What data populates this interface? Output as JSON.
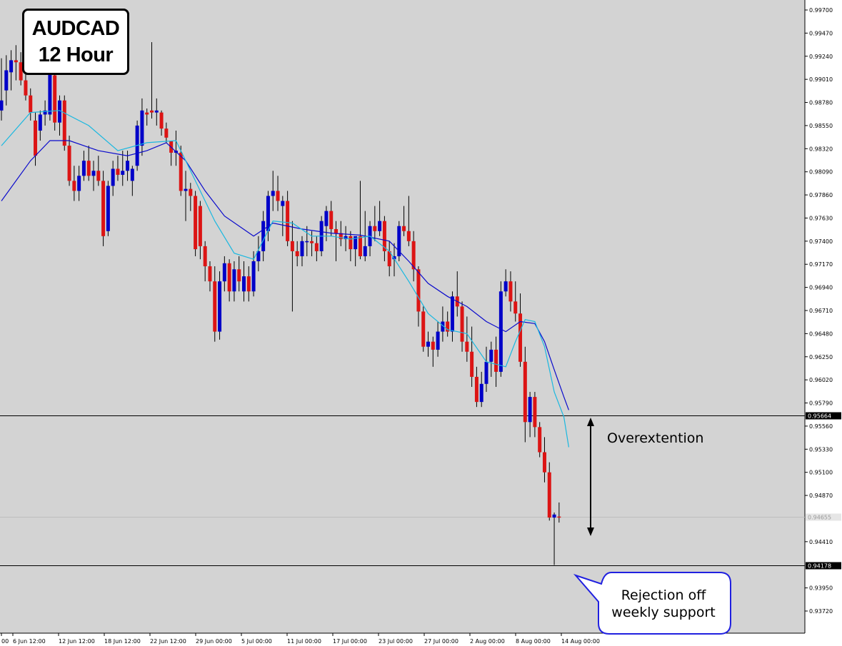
{
  "title": {
    "line1": "AUDCAD",
    "line2": "12 Hour"
  },
  "annotations": {
    "overextension": "Overextention",
    "rejection_line1": "Rejection off",
    "rejection_line2": "weekly support"
  },
  "colors": {
    "background": "#d3d3d3",
    "bull_candle": "#0000c8",
    "bear_candle": "#dc1414",
    "wick": "#000000",
    "ema_fast": "#1ab8e0",
    "ema_slow": "#0a0acc",
    "level_line": "#000000",
    "callout_border": "#2020e0"
  },
  "chart_data": {
    "type": "candlestick",
    "symbol": "AUDCAD",
    "timeframe": "12 Hour",
    "y_ticks": [
      "0.99700",
      "0.99470",
      "0.99240",
      "0.99010",
      "0.98780",
      "0.98550",
      "0.98320",
      "0.98090",
      "0.97860",
      "0.97630",
      "0.97400",
      "0.97170",
      "0.96940",
      "0.96710",
      "0.96480",
      "0.96250",
      "0.96020",
      "0.95790",
      "0.95560",
      "0.95330",
      "0.95100",
      "0.94870",
      "0.94410",
      "0.93950",
      "0.93720"
    ],
    "x_ticks": [
      "00",
      "6 Jun 12:00",
      "12 Jun 12:00",
      "18 Jun 12:00",
      "22 Jun 12:00",
      "29 Jun 00:00",
      "5 Jul 00:00",
      "11 Jul 00:00",
      "17 Jul 00:00",
      "23 Jul 00:00",
      "27 Jul 00:00",
      "2 Aug 00:00",
      "8 Aug 00:00",
      "14 Aug 00:00"
    ],
    "ylim": [
      0.936,
      0.998
    ],
    "levels": [
      {
        "value": 0.95664,
        "label": "0.95664"
      },
      {
        "value": 0.94178,
        "label": "0.94178"
      }
    ],
    "current_price": {
      "value": 0.94655,
      "label": "0.94655"
    },
    "candles": [
      [
        0.987,
        0.9922,
        0.986,
        0.988
      ],
      [
        0.989,
        0.9925,
        0.9875,
        0.991
      ],
      [
        0.9908,
        0.993,
        0.989,
        0.992
      ],
      [
        0.992,
        0.9935,
        0.99,
        0.9918
      ],
      [
        0.9918,
        0.9928,
        0.9895,
        0.99
      ],
      [
        0.99,
        0.991,
        0.988,
        0.9885
      ],
      [
        0.9885,
        0.9892,
        0.986,
        0.9868
      ],
      [
        0.986,
        0.9868,
        0.9815,
        0.9825
      ],
      [
        0.985,
        0.987,
        0.984,
        0.9866
      ],
      [
        0.9866,
        0.988,
        0.9855,
        0.987
      ],
      [
        0.9866,
        0.992,
        0.986,
        0.991
      ],
      [
        0.9905,
        0.9915,
        0.985,
        0.9858
      ],
      [
        0.9858,
        0.9885,
        0.9845,
        0.988
      ],
      [
        0.988,
        0.9885,
        0.983,
        0.9835
      ],
      [
        0.9835,
        0.9845,
        0.9795,
        0.98
      ],
      [
        0.98,
        0.9815,
        0.978,
        0.979
      ],
      [
        0.979,
        0.9815,
        0.978,
        0.9805
      ],
      [
        0.9805,
        0.983,
        0.98,
        0.982
      ],
      [
        0.982,
        0.9835,
        0.98,
        0.9805
      ],
      [
        0.9805,
        0.982,
        0.979,
        0.981
      ],
      [
        0.981,
        0.9825,
        0.9795,
        0.98
      ],
      [
        0.98,
        0.981,
        0.9735,
        0.9745
      ],
      [
        0.975,
        0.98,
        0.9745,
        0.9795
      ],
      [
        0.9795,
        0.982,
        0.9785,
        0.9812
      ],
      [
        0.9812,
        0.9825,
        0.98,
        0.9806
      ],
      [
        0.9806,
        0.983,
        0.9795,
        0.981
      ],
      [
        0.981,
        0.983,
        0.98,
        0.982
      ],
      [
        0.98,
        0.9815,
        0.9785,
        0.9812
      ],
      [
        0.9815,
        0.986,
        0.981,
        0.9855
      ],
      [
        0.9835,
        0.9882,
        0.9825,
        0.987
      ],
      [
        0.9868,
        0.9872,
        0.9855,
        0.9866
      ],
      [
        0.987,
        0.9938,
        0.9862,
        0.9868
      ],
      [
        0.9868,
        0.9882,
        0.9855,
        0.987
      ],
      [
        0.9868,
        0.987,
        0.9845,
        0.9852
      ],
      [
        0.9852,
        0.9858,
        0.9838,
        0.9843
      ],
      [
        0.984,
        0.9838,
        0.9815,
        0.9828
      ],
      [
        0.9828,
        0.985,
        0.9815,
        0.983
      ],
      [
        0.9828,
        0.9835,
        0.9785,
        0.979
      ],
      [
        0.979,
        0.981,
        0.976,
        0.9792
      ],
      [
        0.9792,
        0.9798,
        0.977,
        0.9785
      ],
      [
        0.9785,
        0.979,
        0.9725,
        0.9732
      ],
      [
        0.9775,
        0.978,
        0.9722,
        0.9735
      ],
      [
        0.9735,
        0.974,
        0.97,
        0.9715
      ],
      [
        0.9715,
        0.972,
        0.969,
        0.97
      ],
      [
        0.97,
        0.9715,
        0.964,
        0.965
      ],
      [
        0.965,
        0.971,
        0.9642,
        0.97
      ],
      [
        0.97,
        0.9725,
        0.969,
        0.9718
      ],
      [
        0.9718,
        0.9722,
        0.968,
        0.969
      ],
      [
        0.969,
        0.972,
        0.968,
        0.9712
      ],
      [
        0.9712,
        0.9725,
        0.969,
        0.97
      ],
      [
        0.969,
        0.972,
        0.968,
        0.9705
      ],
      [
        0.9705,
        0.9715,
        0.968,
        0.969
      ],
      [
        0.969,
        0.973,
        0.9685,
        0.972
      ],
      [
        0.972,
        0.9745,
        0.971,
        0.973
      ],
      [
        0.973,
        0.977,
        0.972,
        0.976
      ],
      [
        0.975,
        0.979,
        0.974,
        0.9785
      ],
      [
        0.9785,
        0.981,
        0.977,
        0.979
      ],
      [
        0.979,
        0.9805,
        0.977,
        0.978
      ],
      [
        0.9775,
        0.9785,
        0.9745,
        0.978
      ],
      [
        0.978,
        0.979,
        0.9735,
        0.974
      ],
      [
        0.974,
        0.976,
        0.967,
        0.973
      ],
      [
        0.973,
        0.974,
        0.9715,
        0.9725
      ],
      [
        0.9725,
        0.9745,
        0.9715,
        0.974
      ],
      [
        0.974,
        0.9755,
        0.9725,
        0.974
      ],
      [
        0.974,
        0.975,
        0.9725,
        0.9738
      ],
      [
        0.9738,
        0.9745,
        0.972,
        0.973
      ],
      [
        0.973,
        0.9765,
        0.9725,
        0.976
      ],
      [
        0.9755,
        0.9775,
        0.974,
        0.977
      ],
      [
        0.977,
        0.978,
        0.9745,
        0.9752
      ],
      [
        0.9752,
        0.976,
        0.972,
        0.9748
      ],
      [
        0.9748,
        0.976,
        0.9735,
        0.9742
      ],
      [
        0.9742,
        0.9755,
        0.973,
        0.9745
      ],
      [
        0.9745,
        0.975,
        0.972,
        0.9732
      ],
      [
        0.9732,
        0.974,
        0.9715,
        0.9745
      ],
      [
        0.9745,
        0.98,
        0.9722,
        0.9725
      ],
      [
        0.9725,
        0.977,
        0.972,
        0.9735
      ],
      [
        0.9735,
        0.976,
        0.9725,
        0.9755
      ],
      [
        0.9755,
        0.9775,
        0.974,
        0.975
      ],
      [
        0.975,
        0.978,
        0.9745,
        0.976
      ],
      [
        0.976,
        0.9765,
        0.972,
        0.973
      ],
      [
        0.973,
        0.974,
        0.9705,
        0.9715
      ],
      [
        0.9722,
        0.9738,
        0.9705,
        0.9725
      ],
      [
        0.9725,
        0.976,
        0.972,
        0.9755
      ],
      [
        0.9755,
        0.9775,
        0.9745,
        0.975
      ],
      [
        0.975,
        0.9785,
        0.9735,
        0.974
      ],
      [
        0.974,
        0.975,
        0.97,
        0.9712
      ],
      [
        0.9712,
        0.9715,
        0.9655,
        0.967
      ],
      [
        0.967,
        0.9675,
        0.963,
        0.9635
      ],
      [
        0.9635,
        0.965,
        0.9625,
        0.964
      ],
      [
        0.964,
        0.9645,
        0.9615,
        0.9632
      ],
      [
        0.9632,
        0.966,
        0.9625,
        0.965
      ],
      [
        0.965,
        0.9675,
        0.964,
        0.966
      ],
      [
        0.966,
        0.967,
        0.9645,
        0.965
      ],
      [
        0.965,
        0.969,
        0.964,
        0.9685
      ],
      [
        0.9685,
        0.971,
        0.9665,
        0.9675
      ],
      [
        0.9675,
        0.968,
        0.963,
        0.964
      ],
      [
        0.964,
        0.9665,
        0.962,
        0.963
      ],
      [
        0.963,
        0.9655,
        0.9595,
        0.9605
      ],
      [
        0.9605,
        0.9615,
        0.9575,
        0.958
      ],
      [
        0.958,
        0.961,
        0.9575,
        0.9598
      ],
      [
        0.9598,
        0.9635,
        0.959,
        0.962
      ],
      [
        0.962,
        0.964,
        0.9605,
        0.9632
      ],
      [
        0.9632,
        0.9645,
        0.9595,
        0.961
      ],
      [
        0.961,
        0.97,
        0.9605,
        0.969
      ],
      [
        0.969,
        0.9712,
        0.9685,
        0.97
      ],
      [
        0.97,
        0.971,
        0.967,
        0.968
      ],
      [
        0.968,
        0.97,
        0.966,
        0.9668
      ],
      [
        0.9668,
        0.9688,
        0.9615,
        0.962
      ],
      [
        0.962,
        0.9635,
        0.954,
        0.956
      ],
      [
        0.956,
        0.959,
        0.9545,
        0.9585
      ],
      [
        0.9585,
        0.959,
        0.9545,
        0.9555
      ],
      [
        0.9555,
        0.956,
        0.9525,
        0.953
      ],
      [
        0.953,
        0.9545,
        0.95,
        0.951
      ],
      [
        0.951,
        0.952,
        0.9462,
        0.9465
      ],
      [
        0.9465,
        0.947,
        0.94178,
        0.9468
      ],
      [
        0.9466,
        0.948,
        0.946,
        0.94655
      ]
    ],
    "ema_fast": [
      [
        0,
        0.9835
      ],
      [
        6,
        0.9868
      ],
      [
        12,
        0.987
      ],
      [
        18,
        0.9855
      ],
      [
        24,
        0.983
      ],
      [
        30,
        0.9838
      ],
      [
        36,
        0.984
      ],
      [
        40,
        0.98
      ],
      [
        44,
        0.976
      ],
      [
        48,
        0.9728
      ],
      [
        52,
        0.9722
      ],
      [
        56,
        0.976
      ],
      [
        60,
        0.9758
      ],
      [
        64,
        0.9745
      ],
      [
        68,
        0.9745
      ],
      [
        72,
        0.9742
      ],
      [
        76,
        0.9745
      ],
      [
        80,
        0.973
      ],
      [
        84,
        0.97
      ],
      [
        88,
        0.9668
      ],
      [
        92,
        0.9652
      ],
      [
        96,
        0.9648
      ],
      [
        100,
        0.962
      ],
      [
        104,
        0.9615
      ],
      [
        106,
        0.964
      ],
      [
        108,
        0.9662
      ],
      [
        110,
        0.966
      ],
      [
        112,
        0.9635
      ],
      [
        114,
        0.959
      ],
      [
        116,
        0.9565
      ],
      [
        117,
        0.9535
      ]
    ],
    "ema_slow": [
      [
        0,
        0.978
      ],
      [
        6,
        0.982
      ],
      [
        10,
        0.984
      ],
      [
        14,
        0.984
      ],
      [
        20,
        0.983
      ],
      [
        26,
        0.9825
      ],
      [
        30,
        0.983
      ],
      [
        34,
        0.9838
      ],
      [
        38,
        0.982
      ],
      [
        42,
        0.979
      ],
      [
        46,
        0.9765
      ],
      [
        52,
        0.9745
      ],
      [
        56,
        0.9758
      ],
      [
        62,
        0.9752
      ],
      [
        68,
        0.9748
      ],
      [
        74,
        0.9746
      ],
      [
        80,
        0.974
      ],
      [
        84,
        0.972
      ],
      [
        88,
        0.9698
      ],
      [
        92,
        0.9685
      ],
      [
        96,
        0.9675
      ],
      [
        100,
        0.966
      ],
      [
        104,
        0.965
      ],
      [
        107,
        0.966
      ],
      [
        110,
        0.9658
      ],
      [
        112,
        0.964
      ],
      [
        114,
        0.9612
      ],
      [
        116,
        0.9585
      ],
      [
        117,
        0.9572
      ]
    ]
  }
}
